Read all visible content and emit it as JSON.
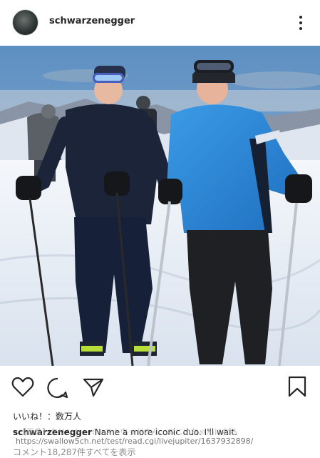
{
  "header": {
    "username": "schwarzenegger",
    "more_icon": "more-vertical-icon"
  },
  "actions": {
    "like_icon": "heart-icon",
    "comment_icon": "comment-icon",
    "share_icon": "send-icon",
    "save_icon": "bookmark-icon"
  },
  "post": {
    "likes_text": "いいね！：数万人",
    "caption_username": "schwarzenegger",
    "caption_text": " Name a more iconic duo. I'll wait.",
    "overlay_text": "【画像】クリント・イーストウッドさん、おじいちゃんになる",
    "source_url": "https://swallow5ch.net/test/read.cgi/livejupiter/1637932898/",
    "comments_link": "コメント18,287件すべてを表示"
  },
  "colors": {
    "text": "#262626",
    "secondary_text": "#8e8e8e",
    "jacket_blue": "#2f8ad6",
    "jacket_navy": "#1b2438",
    "sky": "#6f9cc8",
    "snow": "#eef2f7"
  }
}
